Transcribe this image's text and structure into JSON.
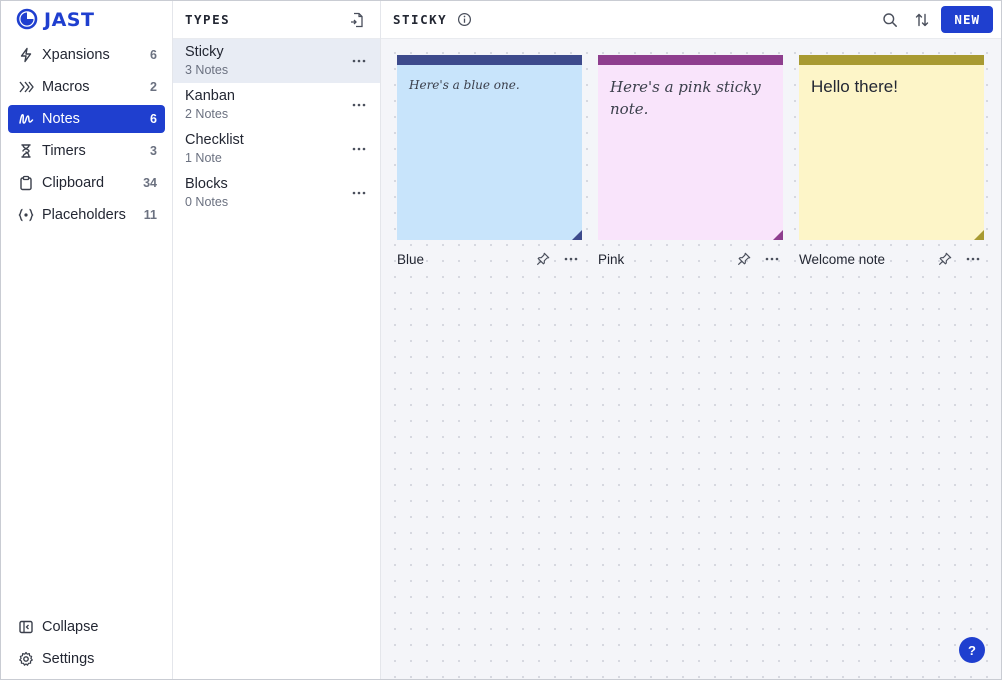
{
  "app": {
    "logo_text": "JAST"
  },
  "sidebar": {
    "items": [
      {
        "label": "Xpansions",
        "count": "6"
      },
      {
        "label": "Macros",
        "count": "2"
      },
      {
        "label": "Notes",
        "count": "6"
      },
      {
        "label": "Timers",
        "count": "3"
      },
      {
        "label": "Clipboard",
        "count": "34"
      },
      {
        "label": "Placeholders",
        "count": "11"
      }
    ],
    "collapse_label": "Collapse",
    "settings_label": "Settings"
  },
  "types": {
    "title": "TYPES",
    "items": [
      {
        "name": "Sticky",
        "count": "3 Notes"
      },
      {
        "name": "Kanban",
        "count": "2 Notes"
      },
      {
        "name": "Checklist",
        "count": "1 Note"
      },
      {
        "name": "Blocks",
        "count": "0 Notes"
      }
    ]
  },
  "main": {
    "title": "STICKY",
    "new_label": "NEW",
    "help_label": "?"
  },
  "notes": [
    {
      "label": "Blue",
      "text": "Here's a blue one.",
      "bar_color": "#3d4a8c",
      "body_color": "#c8e4fb",
      "corner_color": "#3d4a8c"
    },
    {
      "label": "Pink",
      "text": "Here's a pink sticky note.",
      "bar_color": "#8e3e8e",
      "body_color": "#f9e4fb",
      "corner_color": "#8e3e8e"
    },
    {
      "label": "Welcome note",
      "text": "Hello there!",
      "bar_color": "#a89a32",
      "body_color": "#fdf5c8",
      "corner_color": "#a89a32"
    }
  ],
  "colors": {
    "accent": "#1f3fcf",
    "board_bg": "#f4f5f9"
  }
}
